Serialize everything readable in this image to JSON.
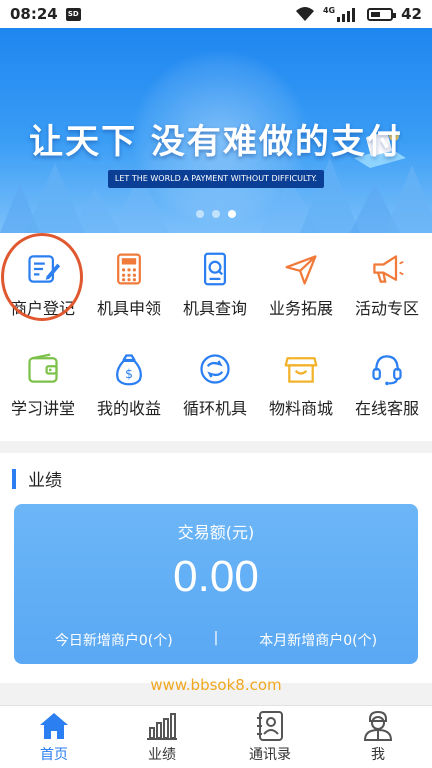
{
  "status_bar": {
    "time": "08:24",
    "sd_label": "SD",
    "network": "4G",
    "battery": "42"
  },
  "banner": {
    "title": "让天下 没有难做的支付",
    "subtitle": "LET THE WORLD A PAYMENT WITHOUT DIFFICULTY.",
    "slides": 3,
    "active_slide": 3
  },
  "menu": {
    "items": [
      {
        "label": "商户登记",
        "icon": "edit-form-icon"
      },
      {
        "label": "机具申领",
        "icon": "calculator-icon"
      },
      {
        "label": "机具查询",
        "icon": "pos-search-icon"
      },
      {
        "label": "业务拓展",
        "icon": "paper-plane-icon"
      },
      {
        "label": "活动专区",
        "icon": "megaphone-icon"
      },
      {
        "label": "学习讲堂",
        "icon": "wallet-icon"
      },
      {
        "label": "我的收益",
        "icon": "money-bag-icon"
      },
      {
        "label": "循环机具",
        "icon": "cycle-icon"
      },
      {
        "label": "物料商城",
        "icon": "shop-icon"
      },
      {
        "label": "在线客服",
        "icon": "headset-icon"
      }
    ]
  },
  "performance": {
    "title": "业绩",
    "amount_label": "交易额(元)",
    "amount_value": "0.00",
    "today_new": "今日新增商户0(个)",
    "separator": "|",
    "month_new": "本月新增商户0(个)"
  },
  "watermark": "www.bbsok8.com",
  "bottom_nav": {
    "items": [
      {
        "label": "首页",
        "icon": "home-icon",
        "active": true
      },
      {
        "label": "业绩",
        "icon": "bar-chart-icon",
        "active": false
      },
      {
        "label": "通讯录",
        "icon": "contacts-icon",
        "active": false
      },
      {
        "label": "我",
        "icon": "user-icon",
        "active": false
      }
    ]
  },
  "colors": {
    "accent": "#2b7ff0",
    "banner_top": "#1e86f0",
    "card": "#5aa8f4",
    "highlight_ring": "#e0582f",
    "watermark": "#f0a820"
  }
}
